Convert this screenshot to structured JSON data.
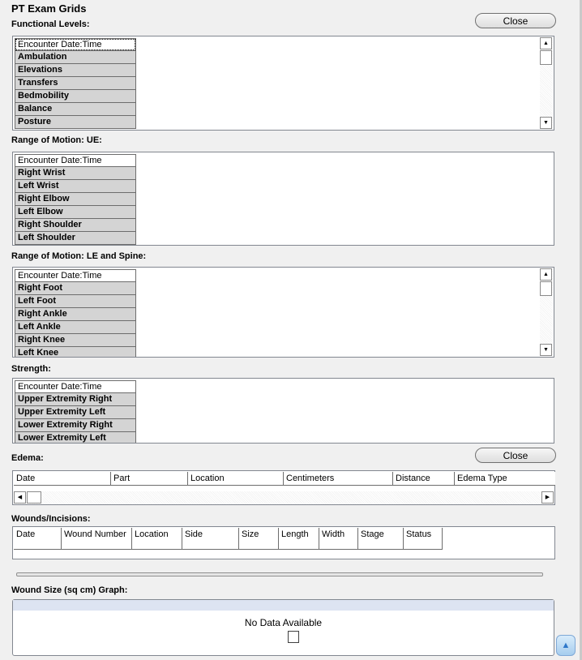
{
  "title": "PT Exam Grids",
  "close_label": "Close",
  "functional_levels": {
    "label": "Functional Levels:",
    "rows": [
      "Encounter Date:Time",
      "Ambulation",
      "Elevations",
      "Transfers",
      "Bedmobility",
      "Balance",
      "Posture"
    ]
  },
  "rom_ue": {
    "label": "Range of Motion: UE:",
    "rows": [
      "Encounter Date:Time",
      "Right Wrist",
      "Left Wrist",
      "Right Elbow",
      "Left Elbow",
      "Right Shoulder",
      "Left Shoulder"
    ]
  },
  "rom_le": {
    "label": "Range of Motion: LE and Spine:",
    "rows": [
      "Encounter Date:Time",
      "Right Foot",
      "Left Foot",
      "Right Ankle",
      "Left Ankle",
      "Right Knee",
      "Left Knee"
    ]
  },
  "strength": {
    "label": "Strength:",
    "rows": [
      "Encounter Date:Time",
      "Upper Extremity Right",
      "Upper Extremity Left",
      "Lower Extremity Right",
      "Lower Extremity Left"
    ]
  },
  "edema": {
    "label": "Edema:",
    "columns": [
      "Date",
      "Part",
      "Location",
      "Centimeters",
      "Distance",
      "Edema Type"
    ]
  },
  "wounds": {
    "label": "Wounds/Incisions:",
    "columns": [
      "Date",
      "Wound Number",
      "Location",
      "Side",
      "Size",
      "Length",
      "Width",
      "Stage",
      "Status"
    ]
  },
  "wound_graph": {
    "label": "Wound Size (sq cm) Graph:",
    "no_data": "No Data Available"
  },
  "icons": {
    "scroll_up": "arrow-up-icon",
    "scroll_down": "arrow-down-icon",
    "scroll_left": "arrow-left-icon",
    "scroll_right": "arrow-right-icon",
    "back_to_top": "triangle-up-icon"
  }
}
